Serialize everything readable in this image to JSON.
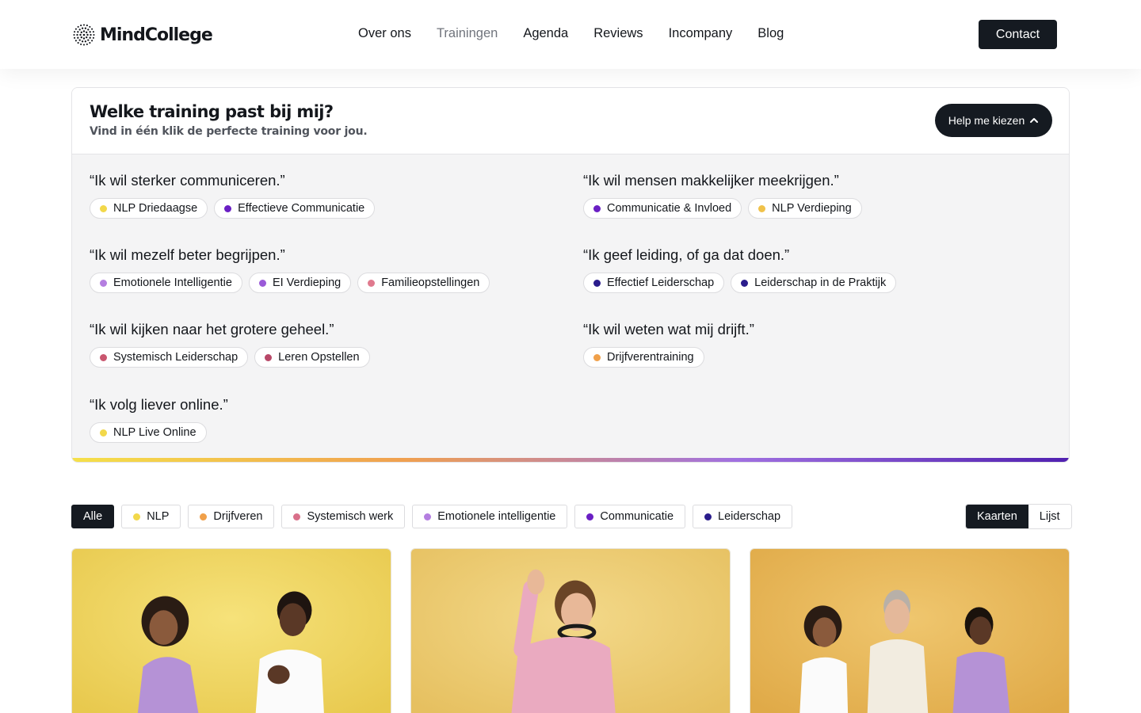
{
  "brand": {
    "name": "MindCollege"
  },
  "nav": {
    "items": [
      {
        "label": "Over ons",
        "active": false
      },
      {
        "label": "Trainingen",
        "active": true
      },
      {
        "label": "Agenda",
        "active": false
      },
      {
        "label": "Reviews",
        "active": false
      },
      {
        "label": "Incompany",
        "active": false
      },
      {
        "label": "Blog",
        "active": false
      }
    ],
    "contact_label": "Contact"
  },
  "finder": {
    "title": "Welke training past bij mij?",
    "subtitle": "Vind in één klik de perfecte training voor jou.",
    "help_label": "Help me kiezen",
    "help_icon": "chevron-up-icon",
    "groups": [
      {
        "quote": "“Ik wil sterker communiceren.”",
        "chips": [
          {
            "label": "NLP Driedaagse",
            "color": "#f2d84a"
          },
          {
            "label": "Effectieve Communicatie",
            "color": "#6a1fc4"
          }
        ]
      },
      {
        "quote": "“Ik wil mensen makkelijker meekrijgen.”",
        "chips": [
          {
            "label": "Communicatie & Invloed",
            "color": "#6a1fc4"
          },
          {
            "label": "NLP Verdieping",
            "color": "#f0c24a"
          }
        ]
      },
      {
        "quote": "“Ik wil mezelf beter begrijpen.”",
        "chips": [
          {
            "label": "Emotionele Intelligentie",
            "color": "#b47ee0"
          },
          {
            "label": "EI Verdieping",
            "color": "#9a5ad8"
          },
          {
            "label": "Familieopstellingen",
            "color": "#e07a8e"
          }
        ]
      },
      {
        "quote": "“Ik geef leiding, of ga dat doen.”",
        "chips": [
          {
            "label": "Effectief Leiderschap",
            "color": "#2a1c8c"
          },
          {
            "label": "Leiderschap in de Praktijk",
            "color": "#2a1c8c"
          }
        ]
      },
      {
        "quote": "“Ik wil kijken naar het grotere geheel.”",
        "chips": [
          {
            "label": "Systemisch Leiderschap",
            "color": "#c9566f"
          },
          {
            "label": "Leren Opstellen",
            "color": "#b84868"
          }
        ]
      },
      {
        "quote": "“Ik wil weten wat mij drijft.”",
        "chips": [
          {
            "label": "Drijfverentraining",
            "color": "#f0a04a"
          }
        ]
      },
      {
        "quote": "“Ik volg liever online.”",
        "chips": [
          {
            "label": "NLP Live Online",
            "color": "#f2d84a"
          }
        ]
      }
    ],
    "gradient_colors": [
      "#f5e04a",
      "#f0a050",
      "#a070e0",
      "#5020b0"
    ]
  },
  "filters": [
    {
      "label": "Alle",
      "active": true,
      "color": null
    },
    {
      "label": "NLP",
      "active": false,
      "color": "#f2d84a"
    },
    {
      "label": "Drijfveren",
      "active": false,
      "color": "#f0a04a"
    },
    {
      "label": "Systemisch werk",
      "active": false,
      "color": "#d9708a"
    },
    {
      "label": "Emotionele intelligentie",
      "active": false,
      "color": "#b47ee0"
    },
    {
      "label": "Communicatie",
      "active": false,
      "color": "#6a1fc4"
    },
    {
      "label": "Leiderschap",
      "active": false,
      "color": "#2a1c8c"
    }
  ],
  "view_toggle": {
    "cards_label": "Kaarten",
    "list_label": "Lijst",
    "active": "Kaarten"
  },
  "cards": [
    {
      "image": "two-women-laughing-photo",
      "bg": "#f2dc6a"
    },
    {
      "image": "woman-waving-photo",
      "bg": "#efd27c"
    },
    {
      "image": "three-people-talking-photo",
      "bg": "#ecc062"
    }
  ]
}
